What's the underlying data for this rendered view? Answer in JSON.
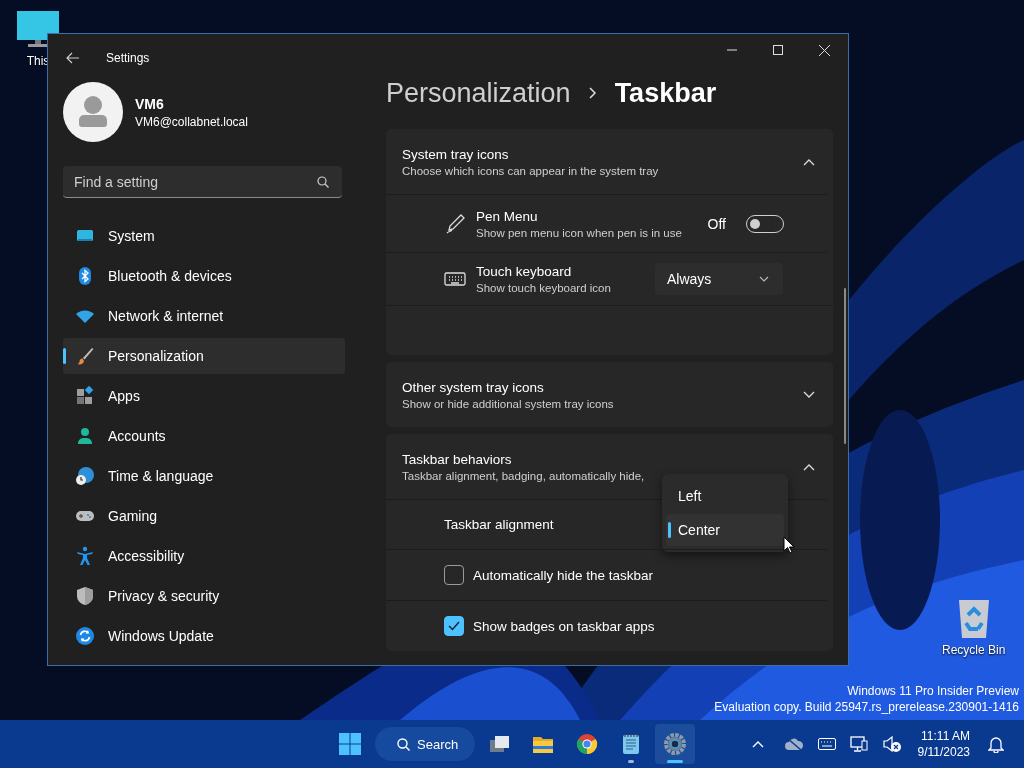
{
  "desktop": {
    "icons": [
      {
        "label": "This"
      },
      {
        "label": "Recycle Bin"
      }
    ],
    "watermark": [
      "Windows 11 Pro Insider Preview",
      "Evaluation copy. Build 25947.rs_prerelease.230901-1416"
    ]
  },
  "window": {
    "title": "Settings",
    "user": {
      "name": "VM6",
      "email": "VM6@collabnet.local"
    },
    "search": {
      "placeholder": "Find a setting"
    },
    "nav": [
      {
        "label": "System",
        "selected": false
      },
      {
        "label": "Bluetooth & devices",
        "selected": false
      },
      {
        "label": "Network & internet",
        "selected": false
      },
      {
        "label": "Personalization",
        "selected": true
      },
      {
        "label": "Apps",
        "selected": false
      },
      {
        "label": "Accounts",
        "selected": false
      },
      {
        "label": "Time & language",
        "selected": false
      },
      {
        "label": "Gaming",
        "selected": false
      },
      {
        "label": "Accessibility",
        "selected": false
      },
      {
        "label": "Privacy & security",
        "selected": false
      },
      {
        "label": "Windows Update",
        "selected": false
      }
    ],
    "breadcrumb": [
      "Personalization",
      "Taskbar"
    ],
    "sections": [
      {
        "title": "System tray icons",
        "subtitle": "Choose which icons can appear in the system tray",
        "expanded": true,
        "rows": [
          {
            "kind": "toggle",
            "title": "Pen Menu",
            "subtitle": "Show pen menu icon when pen is in use",
            "state_label": "Off",
            "on": false
          },
          {
            "kind": "select",
            "title": "Touch keyboard",
            "subtitle": "Show touch keyboard icon",
            "value": "Always"
          }
        ]
      },
      {
        "title": "Other system tray icons",
        "subtitle": "Show or hide additional system tray icons",
        "expanded": false
      },
      {
        "title": "Taskbar behaviors",
        "subtitle": "Taskbar alignment, badging, automatically hide,",
        "expanded": true,
        "rows": [
          {
            "kind": "menu",
            "title": "Taskbar alignment",
            "options": [
              {
                "label": "Left",
                "selected": false
              },
              {
                "label": "Center",
                "selected": true
              }
            ]
          },
          {
            "kind": "checkbox",
            "title": "Automatically hide the taskbar",
            "checked": false
          },
          {
            "kind": "checkbox",
            "title": "Show badges on taskbar apps",
            "checked": true
          }
        ]
      }
    ]
  },
  "taskbar": {
    "search": "Search",
    "apps": [
      {
        "running": false,
        "active": false
      },
      {
        "running": false,
        "active": false
      },
      {
        "running": false,
        "active": false
      },
      {
        "running": true,
        "active": false
      },
      {
        "running": true,
        "active": true
      }
    ],
    "time": "11:11 AM",
    "date": "9/11/2023"
  }
}
